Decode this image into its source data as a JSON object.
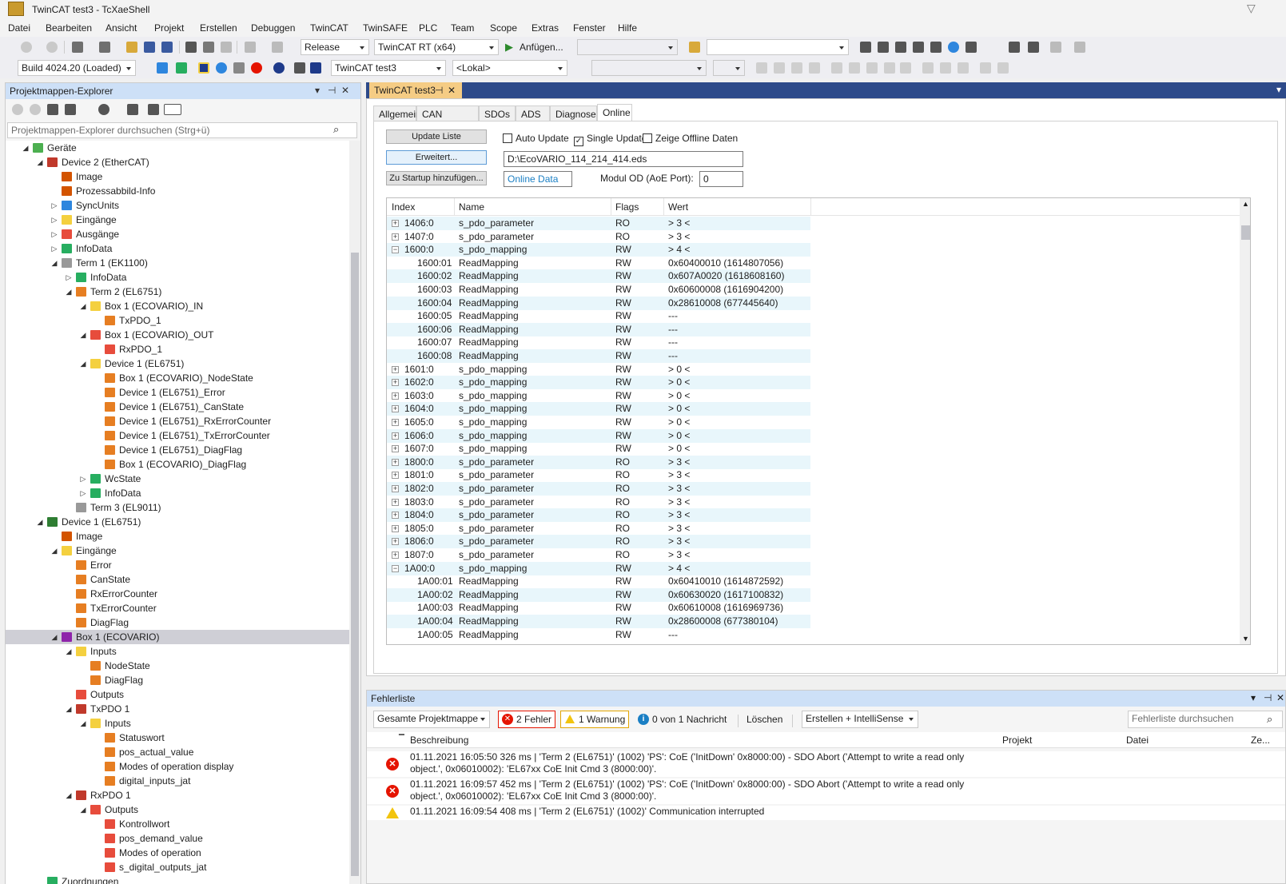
{
  "window": {
    "title": "TwinCAT test3 - TcXaeShell"
  },
  "menu": [
    "Datei",
    "Bearbeiten",
    "Ansicht",
    "Projekt",
    "Erstellen",
    "Debuggen",
    "TwinCAT",
    "TwinSAFE",
    "PLC",
    "Team",
    "Scope",
    "Extras",
    "Fenster",
    "Hilfe"
  ],
  "toolbar1": {
    "config": "Release",
    "platform": "TwinCAT RT (x64)",
    "attach": "Anfügen...",
    "combo_empty": ""
  },
  "toolbar2": {
    "build": "Build 4024.20 (Loaded)",
    "project": "TwinCAT test3",
    "target": "<Lokal>"
  },
  "explorer": {
    "title": "Projektmappen-Explorer",
    "search_placeholder": "Projektmappen-Explorer durchsuchen (Strg+ü)",
    "nodes": [
      {
        "label": "Geräte",
        "level": 2,
        "exp": "◢",
        "icon": "devices-icon",
        "color": "#4caf50"
      },
      {
        "label": "Device 2 (EtherCAT)",
        "level": 3,
        "exp": "◢",
        "icon": "ethercat-device-icon",
        "color": "#c0392b"
      },
      {
        "label": "Image",
        "level": 4,
        "exp": "",
        "icon": "image-icon",
        "color": "#d35400"
      },
      {
        "label": "Prozessabbild-Info",
        "level": 4,
        "exp": "",
        "icon": "process-image-icon",
        "color": "#d35400"
      },
      {
        "label": "SyncUnits",
        "level": 4,
        "exp": "▷",
        "icon": "syncunits-icon",
        "color": "#2e86de"
      },
      {
        "label": "Eingänge",
        "level": 4,
        "exp": "▷",
        "icon": "inputs-folder-icon",
        "color": "#f4d03f"
      },
      {
        "label": "Ausgänge",
        "level": 4,
        "exp": "▷",
        "icon": "outputs-folder-icon",
        "color": "#e74c3c"
      },
      {
        "label": "InfoData",
        "level": 4,
        "exp": "▷",
        "icon": "infodata-icon",
        "color": "#27ae60"
      },
      {
        "label": "Term 1 (EK1100)",
        "level": 4,
        "exp": "◢",
        "icon": "terminal-icon",
        "color": "#999999"
      },
      {
        "label": "InfoData",
        "level": 5,
        "exp": "▷",
        "icon": "infodata-icon",
        "color": "#27ae60"
      },
      {
        "label": "Term 2 (EL6751)",
        "level": 5,
        "exp": "◢",
        "icon": "terminal-icon",
        "color": "#e67e22"
      },
      {
        "label": "Box 1 (ECOVARIO)_IN",
        "level": 6,
        "exp": "◢",
        "icon": "inputs-folder-icon",
        "color": "#f4d03f"
      },
      {
        "label": "TxPDO_1",
        "level": 7,
        "exp": "",
        "icon": "variable-in-icon",
        "color": "#e67e22"
      },
      {
        "label": "Box 1 (ECOVARIO)_OUT",
        "level": 6,
        "exp": "◢",
        "icon": "outputs-folder-icon",
        "color": "#e74c3c"
      },
      {
        "label": "RxPDO_1",
        "level": 7,
        "exp": "",
        "icon": "variable-out-icon",
        "color": "#e74c3c"
      },
      {
        "label": "Device 1 (EL6751)",
        "level": 6,
        "exp": "◢",
        "icon": "inputs-folder-icon",
        "color": "#f4d03f"
      },
      {
        "label": "Box 1 (ECOVARIO)_NodeState",
        "level": 7,
        "exp": "",
        "icon": "variable-in-icon",
        "color": "#e67e22"
      },
      {
        "label": "Device 1 (EL6751)_Error",
        "level": 7,
        "exp": "",
        "icon": "variable-in-icon",
        "color": "#e67e22"
      },
      {
        "label": "Device 1 (EL6751)_CanState",
        "level": 7,
        "exp": "",
        "icon": "variable-in-icon",
        "color": "#e67e22"
      },
      {
        "label": "Device 1 (EL6751)_RxErrorCounter",
        "level": 7,
        "exp": "",
        "icon": "variable-in-icon",
        "color": "#e67e22"
      },
      {
        "label": "Device 1 (EL6751)_TxErrorCounter",
        "level": 7,
        "exp": "",
        "icon": "variable-in-icon",
        "color": "#e67e22"
      },
      {
        "label": "Device 1 (EL6751)_DiagFlag",
        "level": 7,
        "exp": "",
        "icon": "variable-in-icon",
        "color": "#e67e22"
      },
      {
        "label": "Box 1 (ECOVARIO)_DiagFlag",
        "level": 7,
        "exp": "",
        "icon": "variable-in-icon",
        "color": "#e67e22"
      },
      {
        "label": "WcState",
        "level": 6,
        "exp": "▷",
        "icon": "wcstate-icon",
        "color": "#27ae60"
      },
      {
        "label": "InfoData",
        "level": 6,
        "exp": "▷",
        "icon": "infodata-icon",
        "color": "#27ae60"
      },
      {
        "label": "Term 3 (EL9011)",
        "level": 5,
        "exp": "",
        "icon": "terminal-icon",
        "color": "#999999"
      },
      {
        "label": "Device 1 (EL6751)",
        "level": 3,
        "exp": "◢",
        "icon": "cia-device-icon",
        "color": "#2e7d32"
      },
      {
        "label": "Image",
        "level": 4,
        "exp": "",
        "icon": "image-icon",
        "color": "#d35400"
      },
      {
        "label": "Eingänge",
        "level": 4,
        "exp": "◢",
        "icon": "inputs-folder-icon",
        "color": "#f4d03f"
      },
      {
        "label": "Error",
        "level": 5,
        "exp": "",
        "icon": "variable-in-icon",
        "color": "#e67e22"
      },
      {
        "label": "CanState",
        "level": 5,
        "exp": "",
        "icon": "variable-in-icon",
        "color": "#e67e22"
      },
      {
        "label": "RxErrorCounter",
        "level": 5,
        "exp": "",
        "icon": "variable-in-icon",
        "color": "#e67e22"
      },
      {
        "label": "TxErrorCounter",
        "level": 5,
        "exp": "",
        "icon": "variable-in-icon",
        "color": "#e67e22"
      },
      {
        "label": "DiagFlag",
        "level": 5,
        "exp": "",
        "icon": "variable-in-icon",
        "color": "#e67e22"
      },
      {
        "label": "Box 1 (ECOVARIO)",
        "level": 4,
        "exp": "◢",
        "icon": "box-icon",
        "color": "#8e24aa",
        "selected": true
      },
      {
        "label": "Inputs",
        "level": 5,
        "exp": "◢",
        "icon": "inputs-folder-icon",
        "color": "#f4d03f"
      },
      {
        "label": "NodeState",
        "level": 6,
        "exp": "",
        "icon": "variable-in-icon",
        "color": "#e67e22"
      },
      {
        "label": "DiagFlag",
        "level": 6,
        "exp": "",
        "icon": "variable-in-icon",
        "color": "#e67e22"
      },
      {
        "label": "Outputs",
        "level": 5,
        "exp": "",
        "icon": "outputs-folder-icon",
        "color": "#e74c3c"
      },
      {
        "label": "TxPDO 1",
        "level": 5,
        "exp": "◢",
        "icon": "txpdo-icon",
        "color": "#c0392b"
      },
      {
        "label": "Inputs",
        "level": 6,
        "exp": "◢",
        "icon": "inputs-folder-icon",
        "color": "#f4d03f"
      },
      {
        "label": "Statuswort",
        "level": 7,
        "exp": "",
        "icon": "variable-in-icon",
        "color": "#e67e22"
      },
      {
        "label": "pos_actual_value",
        "level": 7,
        "exp": "",
        "icon": "variable-in-icon",
        "color": "#e67e22"
      },
      {
        "label": "Modes of operation display",
        "level": 7,
        "exp": "",
        "icon": "variable-in-icon",
        "color": "#e67e22"
      },
      {
        "label": "digital_inputs_jat",
        "level": 7,
        "exp": "",
        "icon": "variable-in-icon",
        "color": "#e67e22"
      },
      {
        "label": "RxPDO 1",
        "level": 5,
        "exp": "◢",
        "icon": "rxpdo-icon",
        "color": "#c0392b"
      },
      {
        "label": "Outputs",
        "level": 6,
        "exp": "◢",
        "icon": "outputs-folder-icon",
        "color": "#e74c3c"
      },
      {
        "label": "Kontrollwort",
        "level": 7,
        "exp": "",
        "icon": "variable-out-icon",
        "color": "#e74c3c"
      },
      {
        "label": "pos_demand_value",
        "level": 7,
        "exp": "",
        "icon": "variable-out-icon",
        "color": "#e74c3c"
      },
      {
        "label": "Modes of operation",
        "level": 7,
        "exp": "",
        "icon": "variable-out-icon",
        "color": "#e74c3c"
      },
      {
        "label": "s_digital_outputs_jat",
        "level": 7,
        "exp": "",
        "icon": "variable-out-icon",
        "color": "#e74c3c"
      },
      {
        "label": "Zuordnungen",
        "level": 3,
        "exp": "",
        "icon": "mappings-icon",
        "color": "#27ae60"
      }
    ]
  },
  "document": {
    "tab": "TwinCAT test3",
    "tabs": [
      "Allgemein",
      "CAN Knoten",
      "SDOs",
      "ADS",
      "Diagnose",
      "Online"
    ],
    "active_tab": "Online",
    "update_list": "Update Liste",
    "advanced": "Erweitert...",
    "add_startup": "Zu Startup hinzufügen...",
    "auto_update": "Auto Update",
    "single_update": "Single Update",
    "show_offline": "Zeige Offline Daten",
    "eds_path": "D:\\EcoVARIO_114_214_414.eds",
    "online_data": "Online Data",
    "modul_od_label": "Modul OD (AoE Port):",
    "modul_od_value": "0",
    "columns": [
      "Index",
      "Name",
      "Flags",
      "Wert"
    ],
    "rows": [
      {
        "pm": "+",
        "index": "1406:0",
        "name": "s_pdo_parameter",
        "flags": "RO",
        "value": "> 3 <"
      },
      {
        "pm": "+",
        "index": "1407:0",
        "name": "s_pdo_parameter",
        "flags": "RO",
        "value": "> 3 <"
      },
      {
        "pm": "−",
        "index": "1600:0",
        "name": "s_pdo_mapping",
        "flags": "RW",
        "value": "> 4 <"
      },
      {
        "pm": "",
        "index": "1600:01",
        "name": "ReadMapping",
        "flags": "RW",
        "value": "0x60400010 (1614807056)"
      },
      {
        "pm": "",
        "index": "1600:02",
        "name": "ReadMapping",
        "flags": "RW",
        "value": "0x607A0020 (1618608160)"
      },
      {
        "pm": "",
        "index": "1600:03",
        "name": "ReadMapping",
        "flags": "RW",
        "value": "0x60600008 (1616904200)"
      },
      {
        "pm": "",
        "index": "1600:04",
        "name": "ReadMapping",
        "flags": "RW",
        "value": "0x28610008 (677445640)"
      },
      {
        "pm": "",
        "index": "1600:05",
        "name": "ReadMapping",
        "flags": "RW",
        "value": "---"
      },
      {
        "pm": "",
        "index": "1600:06",
        "name": "ReadMapping",
        "flags": "RW",
        "value": "---"
      },
      {
        "pm": "",
        "index": "1600:07",
        "name": "ReadMapping",
        "flags": "RW",
        "value": "---"
      },
      {
        "pm": "",
        "index": "1600:08",
        "name": "ReadMapping",
        "flags": "RW",
        "value": "---"
      },
      {
        "pm": "+",
        "index": "1601:0",
        "name": "s_pdo_mapping",
        "flags": "RW",
        "value": "> 0 <"
      },
      {
        "pm": "+",
        "index": "1602:0",
        "name": "s_pdo_mapping",
        "flags": "RW",
        "value": "> 0 <"
      },
      {
        "pm": "+",
        "index": "1603:0",
        "name": "s_pdo_mapping",
        "flags": "RW",
        "value": "> 0 <"
      },
      {
        "pm": "+",
        "index": "1604:0",
        "name": "s_pdo_mapping",
        "flags": "RW",
        "value": "> 0 <"
      },
      {
        "pm": "+",
        "index": "1605:0",
        "name": "s_pdo_mapping",
        "flags": "RW",
        "value": "> 0 <"
      },
      {
        "pm": "+",
        "index": "1606:0",
        "name": "s_pdo_mapping",
        "flags": "RW",
        "value": "> 0 <"
      },
      {
        "pm": "+",
        "index": "1607:0",
        "name": "s_pdo_mapping",
        "flags": "RW",
        "value": "> 0 <"
      },
      {
        "pm": "+",
        "index": "1800:0",
        "name": "s_pdo_parameter",
        "flags": "RO",
        "value": "> 3 <"
      },
      {
        "pm": "+",
        "index": "1801:0",
        "name": "s_pdo_parameter",
        "flags": "RO",
        "value": "> 3 <"
      },
      {
        "pm": "+",
        "index": "1802:0",
        "name": "s_pdo_parameter",
        "flags": "RO",
        "value": "> 3 <"
      },
      {
        "pm": "+",
        "index": "1803:0",
        "name": "s_pdo_parameter",
        "flags": "RO",
        "value": "> 3 <"
      },
      {
        "pm": "+",
        "index": "1804:0",
        "name": "s_pdo_parameter",
        "flags": "RO",
        "value": "> 3 <"
      },
      {
        "pm": "+",
        "index": "1805:0",
        "name": "s_pdo_parameter",
        "flags": "RO",
        "value": "> 3 <"
      },
      {
        "pm": "+",
        "index": "1806:0",
        "name": "s_pdo_parameter",
        "flags": "RO",
        "value": "> 3 <"
      },
      {
        "pm": "+",
        "index": "1807:0",
        "name": "s_pdo_parameter",
        "flags": "RO",
        "value": "> 3 <"
      },
      {
        "pm": "−",
        "index": "1A00:0",
        "name": "s_pdo_mapping",
        "flags": "RW",
        "value": "> 4 <"
      },
      {
        "pm": "",
        "index": "1A00:01",
        "name": "ReadMapping",
        "flags": "RW",
        "value": "0x60410010 (1614872592)"
      },
      {
        "pm": "",
        "index": "1A00:02",
        "name": "ReadMapping",
        "flags": "RW",
        "value": "0x60630020 (1617100832)"
      },
      {
        "pm": "",
        "index": "1A00:03",
        "name": "ReadMapping",
        "flags": "RW",
        "value": "0x60610008 (1616969736)"
      },
      {
        "pm": "",
        "index": "1A00:04",
        "name": "ReadMapping",
        "flags": "RW",
        "value": "0x28600008 (677380104)"
      },
      {
        "pm": "",
        "index": "1A00:05",
        "name": "ReadMapping",
        "flags": "RW",
        "value": "---"
      }
    ]
  },
  "errors": {
    "title": "Fehlerliste",
    "scope": "Gesamte Projektmappe",
    "errors_btn": "2 Fehler",
    "warnings_btn": "1 Warnung",
    "messages_btn": "0 von 1 Nachricht",
    "clear": "Löschen",
    "build_filter": "Erstellen + IntelliSense",
    "search_placeholder": "Fehlerliste durchsuchen",
    "columns": [
      "Beschreibung",
      "Projekt",
      "Datei",
      "Ze..."
    ],
    "items": [
      {
        "type": "error",
        "text": "01.11.2021 16:05:50 326 ms | 'Term 2 (EL6751)' (1002) 'PS': CoE ('InitDown' 0x8000:00) - SDO Abort ('Attempt to write a read only object.', 0x06010002): 'EL67xx CoE Init Cmd 3 (8000:00)'."
      },
      {
        "type": "error",
        "text": "01.11.2021 16:09:57 452 ms | 'Term 2 (EL6751)' (1002) 'PS': CoE ('InitDown' 0x8000:00) - SDO Abort ('Attempt to write a read only object.', 0x06010002): 'EL67xx CoE Init Cmd 3 (8000:00)'."
      },
      {
        "type": "warning",
        "text": "01.11.2021 16:09:54 408 ms | 'Term 2 (EL6751)' (1002)' Communication interrupted"
      }
    ]
  }
}
